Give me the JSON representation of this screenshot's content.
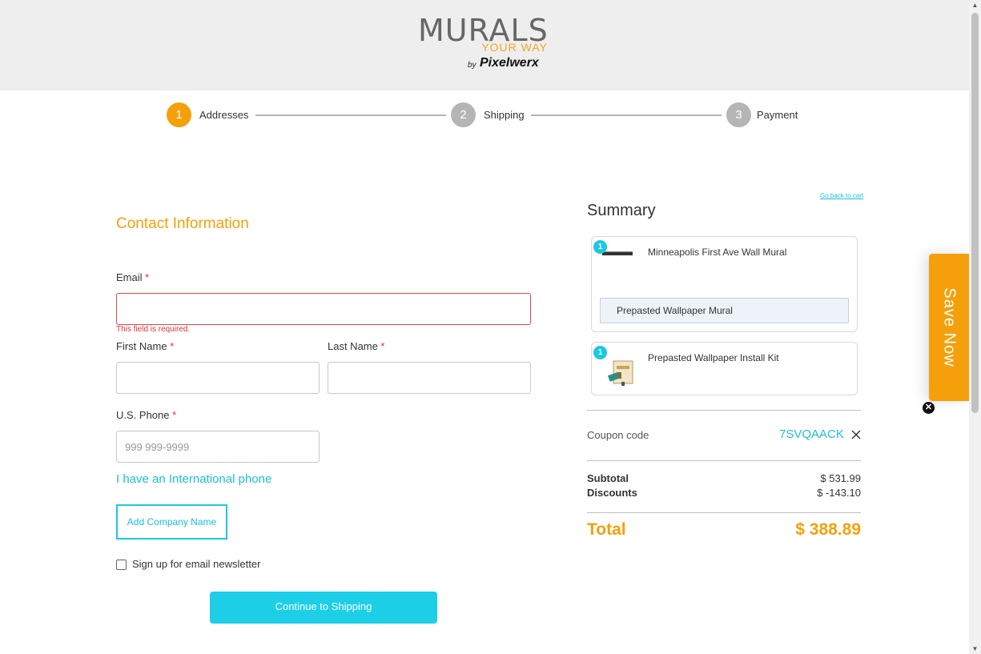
{
  "header": {
    "logo_main": "MURALS",
    "logo_sub": "YOUR WAY",
    "logo_by": "by",
    "logo_brand": "Pixelwerx"
  },
  "steps": [
    {
      "number": "1",
      "label": "Addresses",
      "state": "active"
    },
    {
      "number": "2",
      "label": "Shipping",
      "state": "inactive"
    },
    {
      "number": "3",
      "label": "Payment",
      "state": "inactive"
    }
  ],
  "form": {
    "section_title": "Contact Information",
    "email_label": "Email",
    "required_mark": "*",
    "email_value": "",
    "email_error": "This field is required.",
    "first_name_label": "First Name",
    "first_name_value": "",
    "last_name_label": "Last Name",
    "last_name_value": "",
    "phone_label": "U.S. Phone",
    "phone_placeholder": "999 999-9999",
    "intl_phone_link": "I have an International phone",
    "add_company_button": "Add Company Name",
    "newsletter_label": "Sign up for email newsletter",
    "newsletter_checked": false,
    "continue_button": "Continue to Shipping"
  },
  "summary": {
    "back_link": "Go back to cart",
    "title": "Summary",
    "items": [
      {
        "qty": "1",
        "name": "Minneapolis First Ave Wall Mural",
        "variant": "Prepasted Wallpaper Mural"
      },
      {
        "qty": "1",
        "name": "Prepasted Wallpaper Install Kit"
      }
    ],
    "coupon_label": "Coupon code",
    "coupon_code": "7SVQAACK",
    "subtotal_label": "Subtotal",
    "subtotal_value": "$ 531.99",
    "discounts_label": "Discounts",
    "discounts_value": "$ -143.10",
    "total_label": "Total",
    "total_value": "$ 388.89"
  },
  "promo": {
    "save_now_label": "Save Now"
  },
  "colors": {
    "accent_orange": "#f5a00a",
    "accent_cyan": "#1ccfe6",
    "error_red": "#e04848"
  }
}
